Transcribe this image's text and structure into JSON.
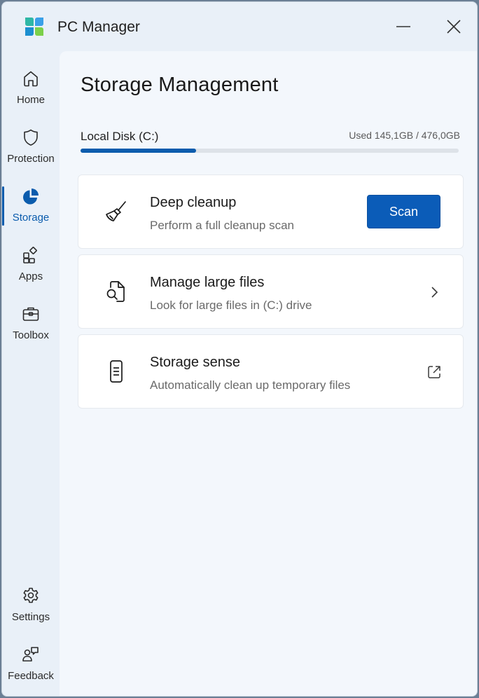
{
  "window": {
    "title": "PC Manager"
  },
  "sidebar": {
    "items": [
      {
        "label": "Home",
        "icon": "home-icon"
      },
      {
        "label": "Protection",
        "icon": "shield-icon"
      },
      {
        "label": "Storage",
        "icon": "pie-chart-icon",
        "active": true
      },
      {
        "label": "Apps",
        "icon": "apps-icon"
      },
      {
        "label": "Toolbox",
        "icon": "toolbox-icon"
      }
    ],
    "bottom_items": [
      {
        "label": "Settings",
        "icon": "gear-icon"
      },
      {
        "label": "Feedback",
        "icon": "feedback-icon"
      }
    ]
  },
  "main": {
    "title": "Storage Management",
    "disk": {
      "label": "Local Disk (C:)",
      "usage_text": "Used 145,1GB / 476,0GB",
      "used_fraction": 0.305
    },
    "cards": [
      {
        "title": "Deep cleanup",
        "subtitle": "Perform a full cleanup scan",
        "icon": "broom-icon",
        "button_label": "Scan"
      },
      {
        "title": "Manage large files",
        "subtitle": "Look for large files in (C:) drive",
        "icon": "file-search-icon",
        "trail_icon": "chevron-right-icon"
      },
      {
        "title": "Storage sense",
        "subtitle": "Automatically clean up temporary files",
        "icon": "phone-storage-icon",
        "trail_icon": "external-link-icon"
      }
    ]
  },
  "colors": {
    "accent": "#0b5cad",
    "window_bg": "#e9f0f8",
    "content_bg": "#f3f7fc"
  }
}
